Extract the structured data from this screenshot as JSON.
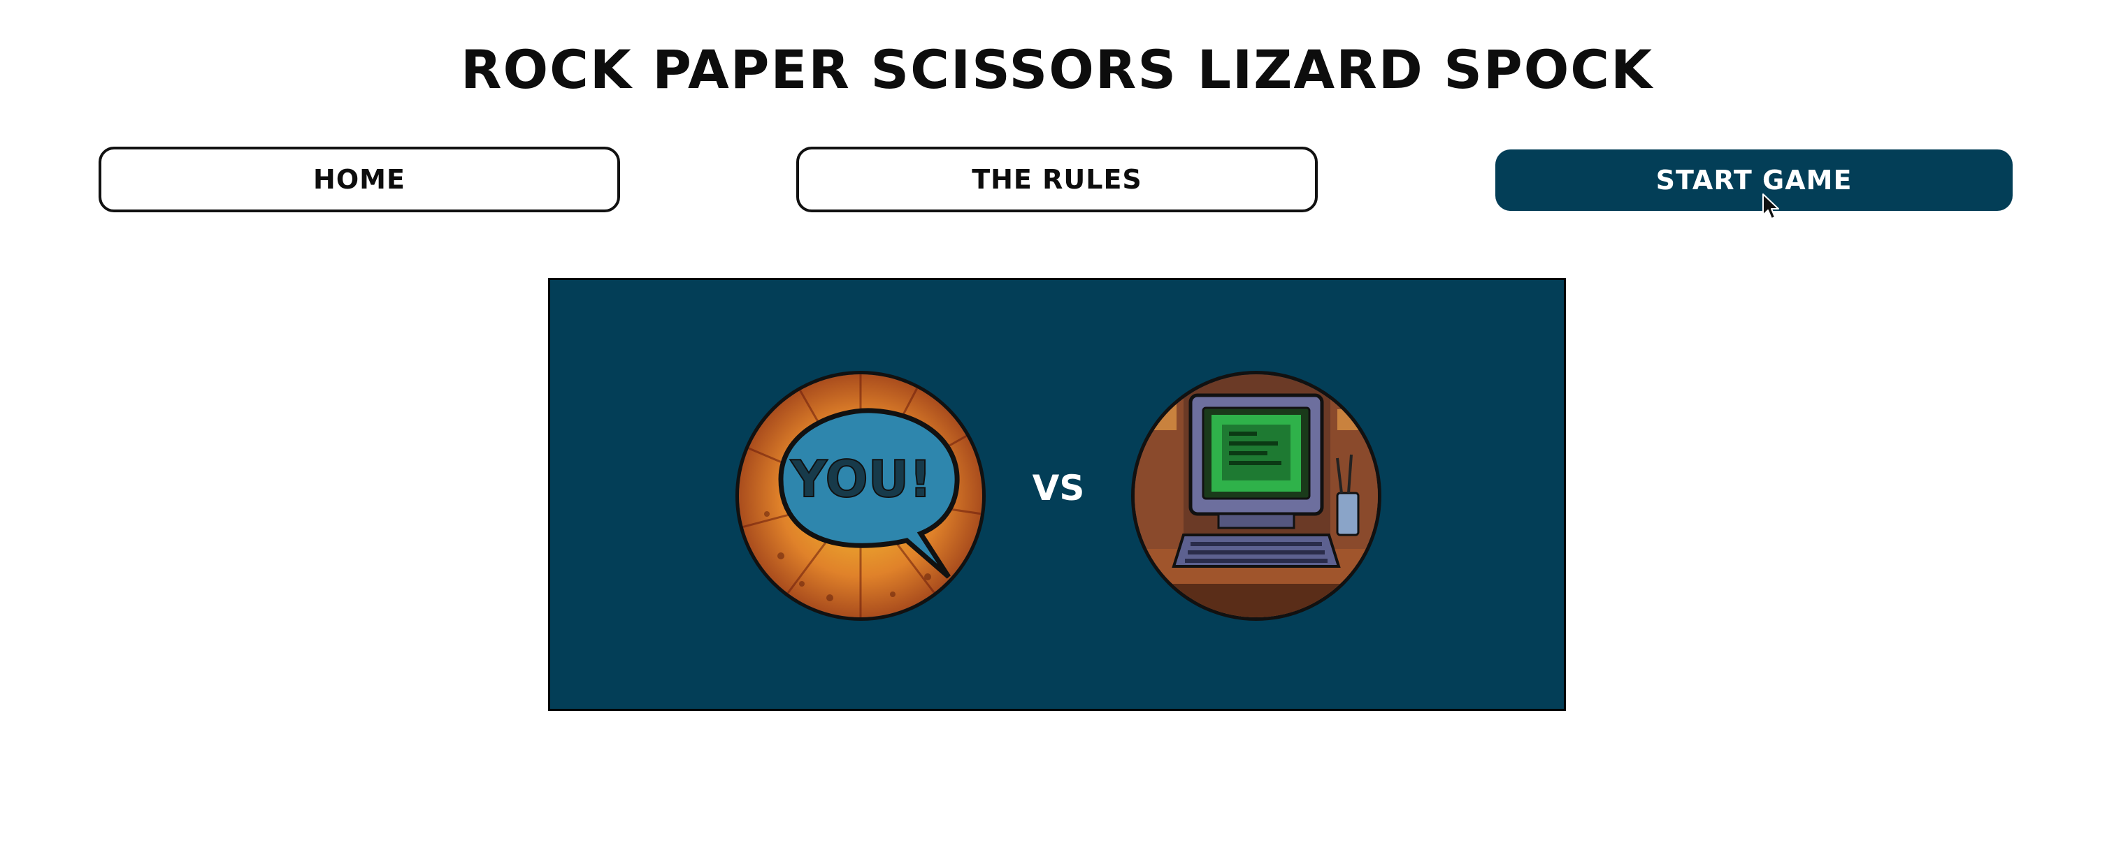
{
  "title": "ROCK PAPER SCISSORS LIZARD SPOCK",
  "nav": {
    "home_label": "HOME",
    "rules_label": "THE RULES",
    "start_label": "START GAME",
    "start_color": "#033e57"
  },
  "stage": {
    "background": "#033e57",
    "player": {
      "image": "comic-speech-bubble",
      "text": "YOU!"
    },
    "vs_label": "VS",
    "opponent": {
      "image": "retro-computer"
    }
  },
  "icons": [
    "cursor-arrow-icon"
  ]
}
